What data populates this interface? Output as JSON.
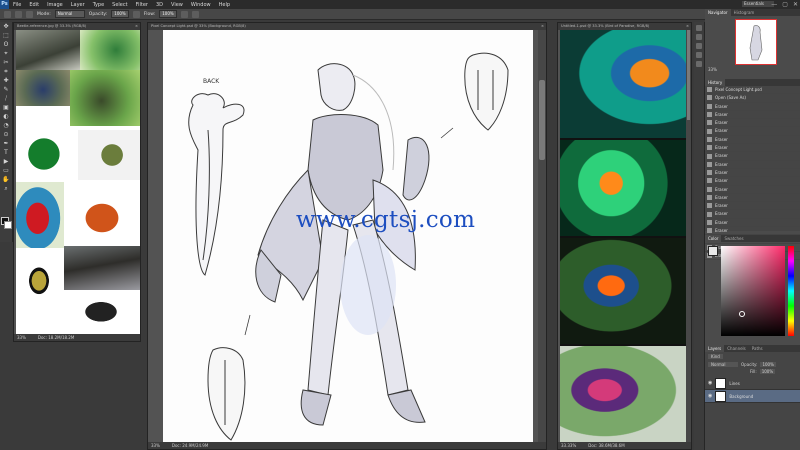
{
  "menubar": {
    "logo": "Ps",
    "items": [
      "File",
      "Edit",
      "Image",
      "Layer",
      "Type",
      "Select",
      "Filter",
      "3D",
      "View",
      "Window",
      "Help"
    ],
    "workspace": "Essentials",
    "controls": [
      "—",
      "▢",
      "✕"
    ]
  },
  "options": {
    "mode_label": "Mode:",
    "mode_value": "Normal",
    "opacity_label": "Opacity:",
    "opacity_value": "100%",
    "flow_label": "Flow:",
    "flow_value": "100%"
  },
  "tools": [
    "✥",
    "⬚",
    "ʘ",
    "⌖",
    "✂",
    "⌗",
    "✚",
    "✎",
    "⧸",
    "▣",
    "◐",
    "◔",
    "⊙",
    "✒",
    "T",
    "▶",
    "▭",
    "✋",
    "⌕"
  ],
  "docs": {
    "beetles": {
      "tab": "Beetle-reference.jpg @ 33.3% (RGB/8)",
      "zoom": "33%",
      "docinfo": "Doc: 18.2M/18.2M",
      "close": "×"
    },
    "sketch": {
      "tab": "Pixel Concept Light.psd @ 33% (Background, RGB/8)",
      "zoom": "33%",
      "docinfo": "Doc: 24.9M/24.9M",
      "close": "×",
      "annotation": "BACK"
    },
    "flowers": {
      "tab": "Untitled-1.psd @ 33.3% (Bird of Paradise, RGB/8)",
      "zoom": "33.33%",
      "docinfo": "Doc: 38.6M/38.6M",
      "close": "×"
    }
  },
  "watermark": "www.cgtsj.com",
  "panels": {
    "navigator": {
      "tabs": [
        "Navigator",
        "Histogram"
      ],
      "zoom": "33%"
    },
    "history": {
      "tabs": [
        "History"
      ],
      "snapshot": "Pixel Concept Light.psd",
      "items": [
        "Open (Save As)",
        "Eraser",
        "Eraser",
        "Eraser",
        "Eraser",
        "Eraser",
        "Eraser",
        "Eraser",
        "Eraser",
        "Eraser",
        "Eraser",
        "Eraser",
        "Eraser",
        "Eraser",
        "Eraser",
        "Eraser",
        "Eraser",
        "Eraser",
        "Eraser",
        "Eraser"
      ]
    },
    "color": {
      "tabs": [
        "Color",
        "Swatches"
      ],
      "fg": "#e8e8e8",
      "hue": "#ff2a6a"
    },
    "layers": {
      "tabs": [
        "Layers",
        "Channels",
        "Paths"
      ],
      "kind": "Kind",
      "blend": "Normal",
      "opacity_label": "Opacity:",
      "opacity": "100%",
      "fill_label": "Fill:",
      "fill": "100%",
      "items": [
        {
          "name": "Lines",
          "selected": false
        },
        {
          "name": "Background",
          "selected": true
        }
      ]
    }
  },
  "colors": {
    "ui_dark": "#2b2b2b",
    "ui_panel": "#4b4b4b",
    "workspace": "#535353",
    "accent_selection": "#5a6b84",
    "watermark_blue": "#1d4ec0"
  }
}
